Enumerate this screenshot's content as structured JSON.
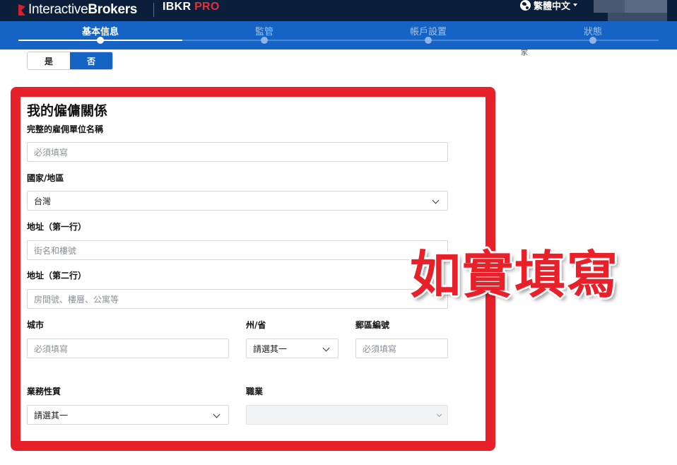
{
  "brand": {
    "name_light": "Interactive",
    "name_bold": "Brokers",
    "product": "IBKR",
    "product_suffix": "PRO",
    "accent": "#d81e2c"
  },
  "header": {
    "language": "繁體中文"
  },
  "stepper": {
    "steps": [
      {
        "label": "基本信息",
        "active": true
      },
      {
        "label": "監管",
        "active": false
      },
      {
        "label": "帳戶設置",
        "active": false
      },
      {
        "label": "狀態",
        "active": false
      }
    ],
    "bar_color": "#1563c4"
  },
  "side_note": "家",
  "toggle": {
    "yes": "是",
    "no": "否",
    "selected": "否"
  },
  "form": {
    "title": "我的僱傭關係",
    "employer_label": "完整的雇佣單位名稱",
    "employer_placeholder": "必須填寫",
    "country_label": "國家/地區",
    "country_value": "台灣",
    "address1_label": "地址（第一行）",
    "address1_placeholder": "街名和樓號",
    "address2_label": "地址（第二行）",
    "address2_placeholder": "房間號、樓層、公寓等",
    "city_label": "城市",
    "city_placeholder": "必須填寫",
    "state_label": "州/省",
    "state_value": "請選其一",
    "zip_label": "郵區編號",
    "zip_placeholder": "必須填寫",
    "business_label": "業務性質",
    "business_value": "請選其一",
    "occupation_label": "職業",
    "occupation_value": ""
  },
  "annotation": {
    "text": "如實填寫",
    "color": "#e8202a"
  }
}
